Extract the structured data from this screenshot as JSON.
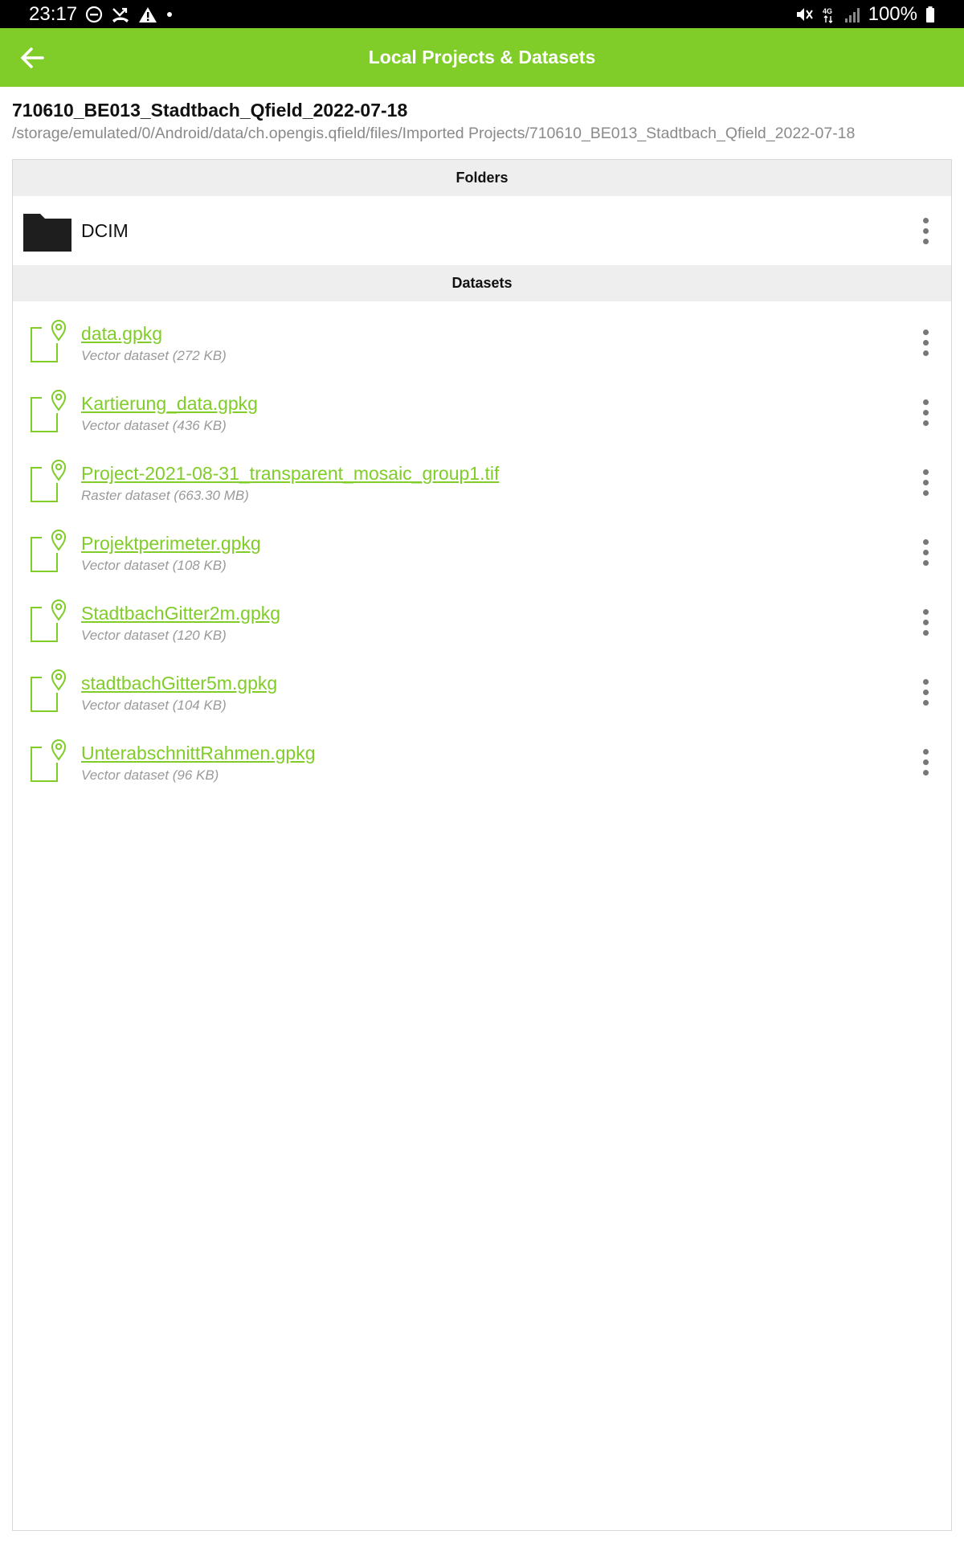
{
  "status_bar": {
    "time": "23:17",
    "battery": "100%",
    "network": "4G",
    "icons_left": [
      "do-not-disturb-icon",
      "missed-call-icon",
      "warning-icon",
      "dot-icon"
    ],
    "icons_right": [
      "mute-icon",
      "network-4g-icon",
      "signal-icon",
      "battery-icon"
    ]
  },
  "app_bar": {
    "title": "Local Projects & Datasets",
    "back_icon": "arrow-left-icon",
    "background": "#80cc28"
  },
  "project": {
    "name": "710610_BE013_Stadtbach_Qfield_2022-07-18",
    "path": "/storage/emulated/0/Android/data/ch.opengis.qfield/files/Imported Projects/710610_BE013_Stadtbach_Qfield_2022-07-18"
  },
  "folders": {
    "header": "Folders",
    "items": [
      {
        "name": "DCIM",
        "icon": "folder-icon"
      }
    ]
  },
  "datasets": {
    "header": "Datasets",
    "items": [
      {
        "name": "data.gpkg",
        "meta": "Vector dataset (272 KB)",
        "icon": "dataset-file-icon"
      },
      {
        "name": "Kartierung_data.gpkg",
        "meta": "Vector dataset (436 KB)",
        "icon": "dataset-file-icon"
      },
      {
        "name": "Project-2021-08-31_transparent_mosaic_group1.tif",
        "meta": "Raster dataset (663.30 MB)",
        "icon": "dataset-file-icon"
      },
      {
        "name": "Projektperimeter.gpkg",
        "meta": "Vector dataset (108 KB)",
        "icon": "dataset-file-icon"
      },
      {
        "name": "StadtbachGitter2m.gpkg",
        "meta": "Vector dataset (120 KB)",
        "icon": "dataset-file-icon"
      },
      {
        "name": "stadtbachGitter5m.gpkg",
        "meta": "Vector dataset (104 KB)",
        "icon": "dataset-file-icon"
      },
      {
        "name": "UnterabschnittRahmen.gpkg",
        "meta": "Vector dataset (96 KB)",
        "icon": "dataset-file-icon"
      }
    ]
  },
  "colors": {
    "accent": "#80cc28",
    "link": "#80cc28",
    "meta_text": "#9a9a9a",
    "section_header_bg": "#eeeeee"
  }
}
